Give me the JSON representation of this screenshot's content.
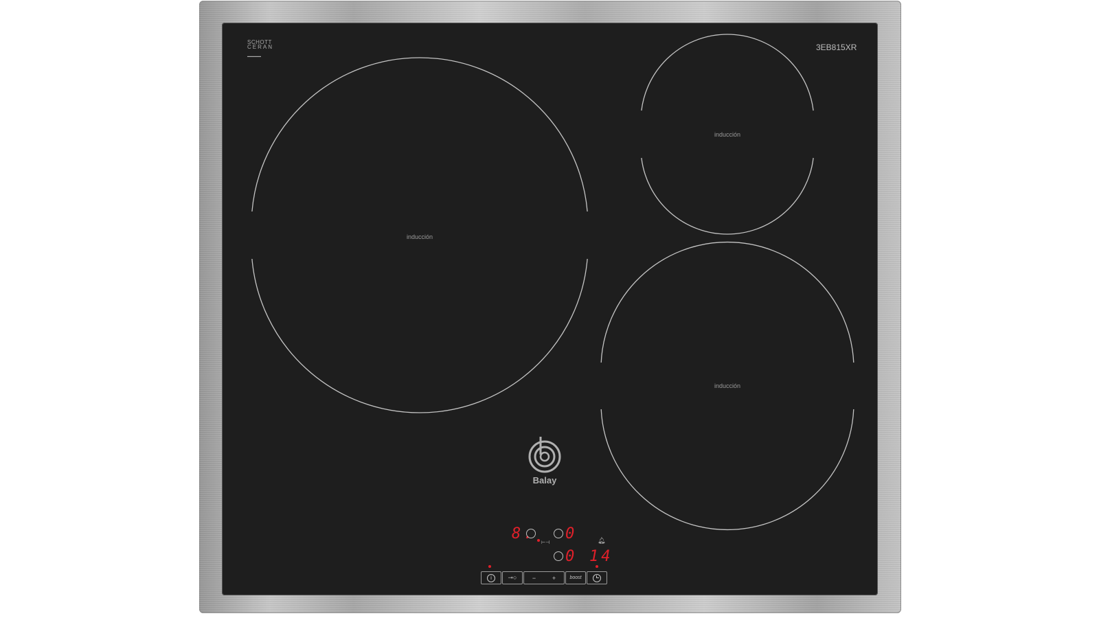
{
  "model": "3EB815XR",
  "glass_brand": {
    "line1": "SCHOTT",
    "line2": "CERAN"
  },
  "zones": {
    "label": "inducción"
  },
  "brand": "Balay",
  "displays": {
    "zone_left": "8.",
    "zone_right_top": "0",
    "zone_right_bottom": "0",
    "timer": "14"
  },
  "controls": {
    "minus": "−",
    "plus": "+",
    "boost": "boost"
  },
  "colors": {
    "glass": "#1e1e1e",
    "frame": "#b8b8b8",
    "display_red": "#e0202a",
    "ring": "#c4c4c4"
  },
  "icons": [
    "info-icon",
    "key-lock-icon",
    "timer-icon",
    "bell-icon",
    "power-level-indicator-icon"
  ]
}
